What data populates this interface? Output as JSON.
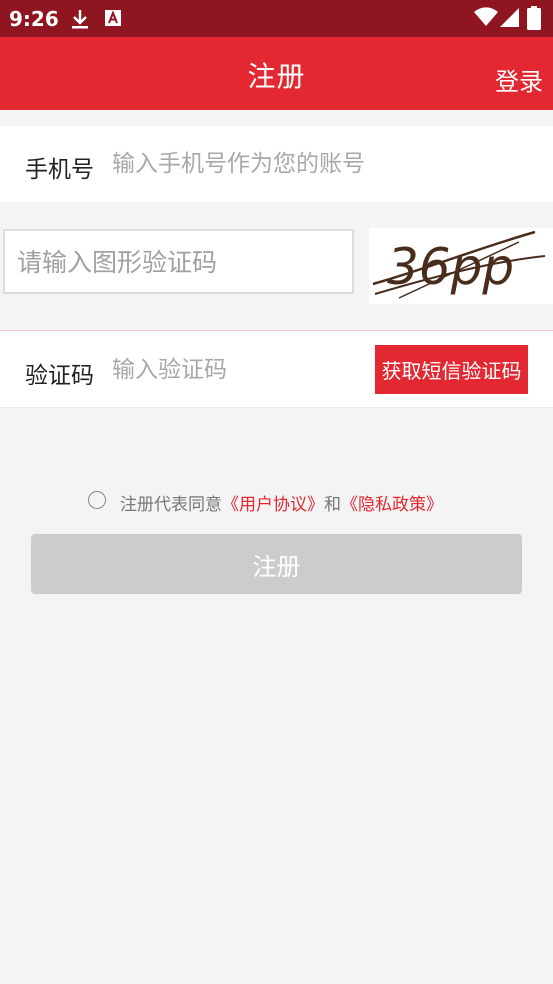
{
  "status_bar": {
    "time": "9:26",
    "icons": [
      "download-icon",
      "font-a-icon",
      "wifi-icon",
      "signal-icon",
      "battery-icon"
    ]
  },
  "app_bar": {
    "title": "注册",
    "login_label": "登录"
  },
  "phone": {
    "label": "手机号",
    "placeholder": "输入手机号作为您的账号",
    "value": ""
  },
  "captcha": {
    "placeholder": "请输入图形验证码",
    "value": "",
    "image_text": "36pp"
  },
  "sms": {
    "label": "验证码",
    "placeholder": "输入验证码",
    "value": "",
    "button_label": "获取短信验证码"
  },
  "agreement": {
    "checked": false,
    "prefix": "注册代表同意",
    "user_agreement": "《用户协议》",
    "conjunction": "和",
    "privacy_policy": "《隐私政策》"
  },
  "submit": {
    "label": "注册",
    "enabled": false
  },
  "colors": {
    "status_bar": "#8f1520",
    "primary": "#e32831",
    "background": "#f4f4f4",
    "disabled_button": "#cccccc"
  }
}
